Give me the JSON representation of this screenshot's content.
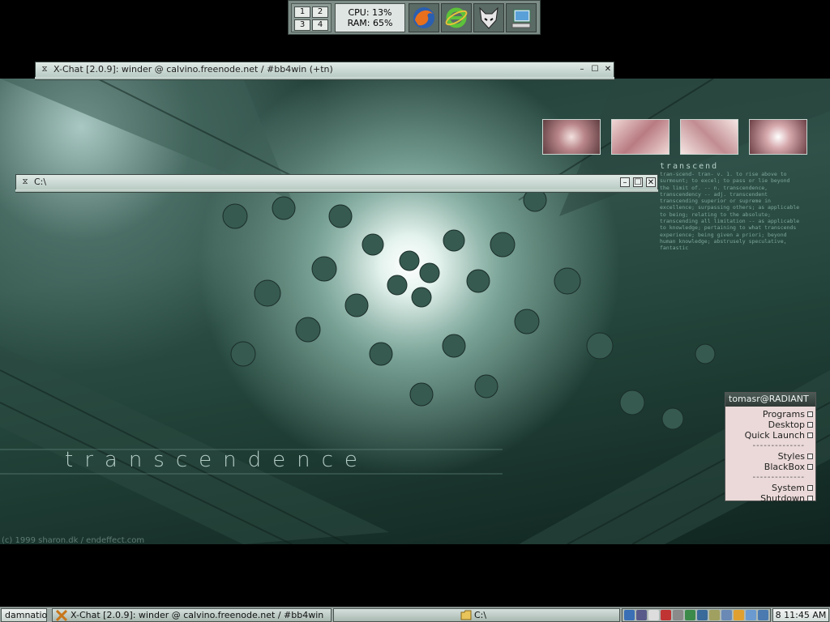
{
  "colors": {
    "wallpaper_dark": "#1d3a33",
    "wallpaper_glow": "#ffffff",
    "menu_bg": "#ead9d8",
    "titlebar": "#b9cbc4"
  },
  "toolbar": {
    "workspaces": [
      "1",
      "2",
      "3",
      "4"
    ],
    "cpu": "CPU: 13%",
    "ram": "RAM: 65%",
    "launchers": [
      {
        "name": "firefox-icon"
      },
      {
        "name": "ie-icon"
      },
      {
        "name": "foobar-icon"
      },
      {
        "name": "computer-icon"
      }
    ]
  },
  "windows": {
    "xchat": {
      "title": "X-Chat [2.0.9]: winder @ calvino.freenode.net / #bb4win (+tn)"
    },
    "explorer": {
      "title": "C:\\"
    }
  },
  "wallpaper": {
    "title": "transcendence",
    "copyright": "(c) 1999 sharon.dk / endeffect.com",
    "block_heading": "transcend",
    "block_text": "tran-scend- tran- v. 1. to rise above to surmount; to excel; to pass or lie beyond the limit of. -- n. transcendence, transcendency -- adj. transcendent transcending superior or supreme in excellence; surpassing others; as applicable to being; relating to the absolute; transcending all limitation -- as applicable to knowledge; pertaining to what transcends experience; being given a priori; beyond human knowledge; abstrusely speculative, fantastic"
  },
  "menu": {
    "title": "tomasr@RADIANT",
    "items": [
      "Programs",
      "Desktop",
      "Quick Launch",
      "Styles",
      "BlackBox",
      "System",
      "Shutdown"
    ],
    "separator": "--------------"
  },
  "taskbar": {
    "workspace": "damnatio",
    "tasks": [
      "X-Chat [2.0.9]: winder @ calvino.freenode.net / #bb4win (+tn)",
      "C:\\"
    ],
    "clock": "8 11:45 AM"
  }
}
